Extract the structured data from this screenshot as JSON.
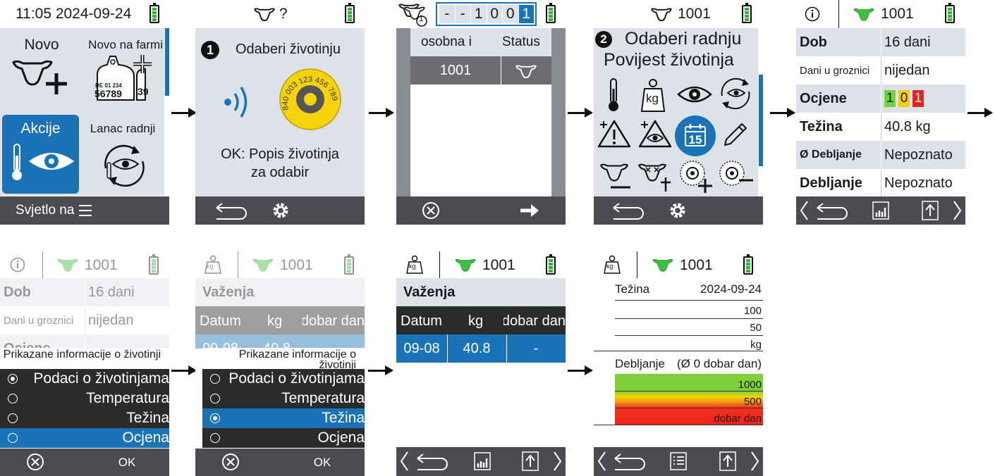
{
  "s1": {
    "time": "11:05 2024-09-24",
    "tile_novo": "Novo",
    "tile_novo_farm": "Novo na farmi",
    "tag_line1": "DE 01 234",
    "tag_line2": "56789",
    "tag_side": "39",
    "tile_akcije": "Akcije",
    "tile_lanac": "Lanac radnji",
    "footer": "Svjetlo na"
  },
  "s2": {
    "title_status": "?",
    "step": "1",
    "heading": "Odaberi životinju",
    "tag_text": "840 003 123 456 789",
    "ok_line1": "OK: Popis životinja",
    "ok_line2": "za odabir"
  },
  "s3": {
    "badge": "1",
    "digits": [
      "-",
      "-",
      "1",
      "0",
      "0",
      "1"
    ],
    "col1": "osobna i",
    "col2": "Status",
    "id": "1001"
  },
  "s4": {
    "id": "1001",
    "step": "2",
    "line1": "Odaberi radnju",
    "line2": "Povijest životinja",
    "kg": "kg",
    "cal": "15"
  },
  "s5": {
    "id": "1001",
    "rows": [
      {
        "label": "Dob",
        "value": "16 dani"
      },
      {
        "label": "Dani u groznici",
        "value": "nijedan"
      },
      {
        "label": "Ocjene",
        "value": ""
      },
      {
        "label": "Težina",
        "value": "40.8 kg"
      },
      {
        "label": "Ø Debljanje",
        "value": "Nepoznato"
      },
      {
        "label": "Debljanje",
        "value": "Nepoznato"
      }
    ],
    "scores": [
      "1",
      "0",
      "1"
    ]
  },
  "s6": {
    "id": "1001",
    "bg_rows": [
      {
        "label": "Dob",
        "value": "16 dani"
      },
      {
        "label": "Dani u groznici",
        "value": "nijedan"
      },
      {
        "label": "Ocjene",
        "value": ""
      }
    ],
    "popup_title": "Prikazane informacije o životinji",
    "options": [
      "Podaci o životinjama",
      "Temperatura",
      "Težina",
      "Ocjena"
    ],
    "ok": "OK"
  },
  "s7": {
    "id": "1001",
    "kg": "kg",
    "bg_title": "Važenja",
    "bg_cols": [
      "Datum",
      "kg",
      "dobar dan"
    ],
    "bg_cells": [
      "09-08",
      "40.8"
    ],
    "popup_title": "Prikazane informacije o životinji",
    "options": [
      "Podaci o životinjama",
      "Temperatura",
      "Težina",
      "Ocjena"
    ],
    "ok": "OK"
  },
  "s8": {
    "id": "1001",
    "kg": "kg",
    "title": "Važenja",
    "cols": [
      "Datum",
      "kg",
      "dobar dan"
    ],
    "row": [
      "09-08",
      "40.8",
      "-"
    ]
  },
  "s9": {
    "id": "1001",
    "kg": "kg",
    "weight_label": "Težina",
    "weight_date": "2024-09-24",
    "w_ticks": [
      "100",
      "50",
      "kg"
    ],
    "gain_label": "Debljanje",
    "gain_avg": "(Ø 0 dobar dan)",
    "g_ticks": [
      "1000",
      "500",
      "dobar dan"
    ]
  },
  "colors": {
    "accent": "#1b73b7",
    "footer": "#4a4c52",
    "tile": "#dde2e9",
    "cow_green": "#3ec13e"
  }
}
